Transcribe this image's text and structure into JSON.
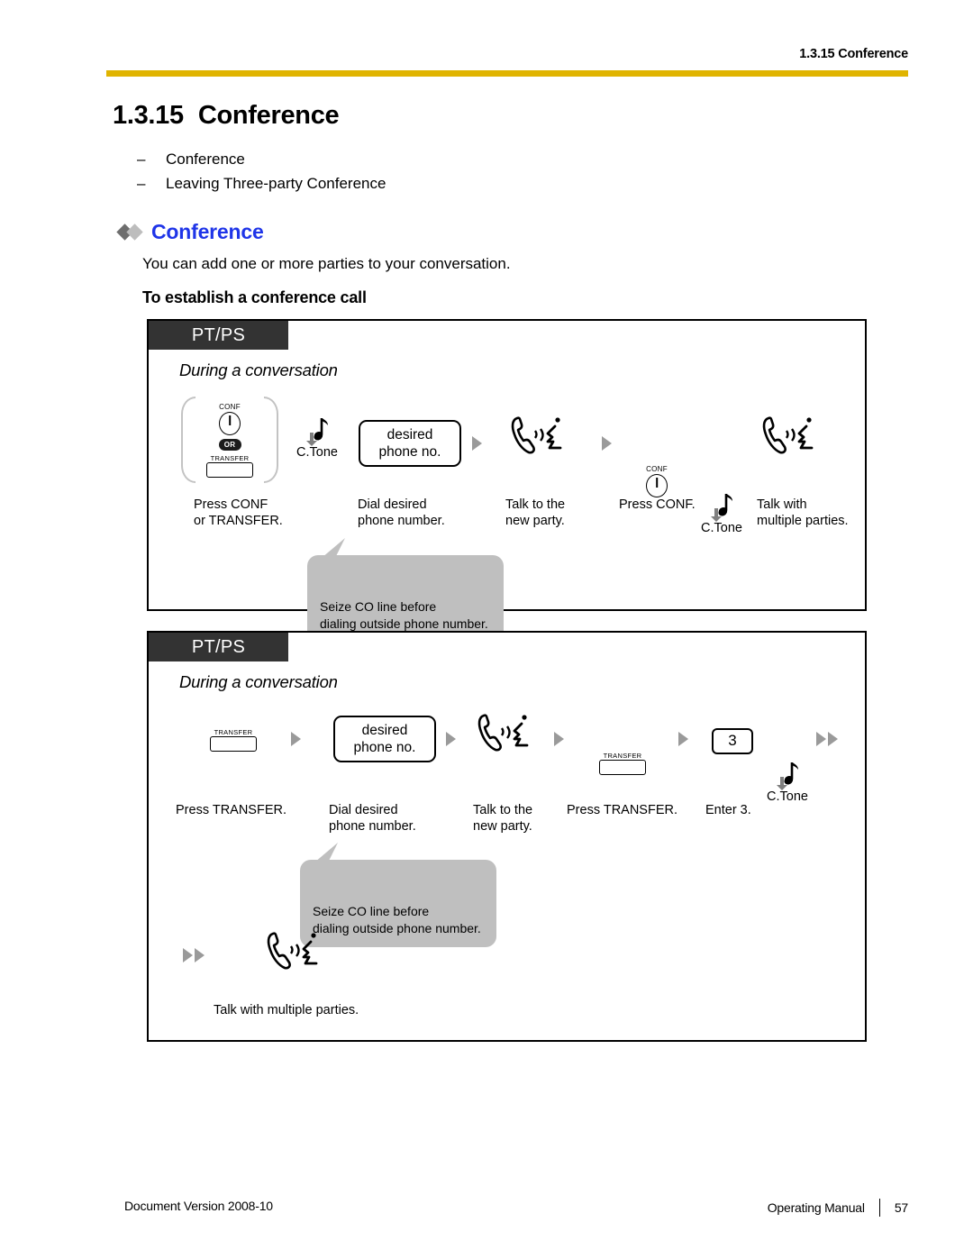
{
  "header": {
    "running_title": "1.3.15 Conference",
    "rule_color": "#e0b400"
  },
  "title": {
    "number": "1.3.15",
    "text": "Conference"
  },
  "toc_items": [
    {
      "dash": "–",
      "label": "Conference"
    },
    {
      "dash": "–",
      "label": "Leaving Three-party Conference"
    }
  ],
  "section": {
    "heading": "Conference",
    "heading_color": "#1f35e8",
    "intro": "You can add one or more parties to your conversation.",
    "subheading": "To establish a conference call"
  },
  "diagram1": {
    "badge": "PT/PS",
    "context": "During a conversation",
    "steps": {
      "conf_key_cap": "CONF",
      "or_badge": "OR",
      "transfer_key_cap": "TRANSFER",
      "ctone_label_1": "C.Tone",
      "phone_no_box": "desired\nphone no.",
      "conf_key_cap_2": "CONF",
      "ctone_label_2": "C.Tone"
    },
    "captions": [
      "Press CONF\nor TRANSFER.",
      "Dial desired\nphone number.",
      "Talk to the\nnew party.",
      "Press CONF.",
      "Talk with\nmultiple parties."
    ],
    "callout": "Seize CO line before\ndialing outside phone number."
  },
  "diagram2": {
    "badge": "PT/PS",
    "context": "During a conversation",
    "steps": {
      "transfer_key_cap_1": "TRANSFER",
      "phone_no_box": "desired\nphone no.",
      "transfer_key_cap_2": "TRANSFER",
      "digit_key": "3",
      "ctone_label": "C.Tone"
    },
    "captions": [
      "Press TRANSFER.",
      "Dial desired\nphone number.",
      "Talk to the\nnew party.",
      "Press TRANSFER.",
      "Enter 3."
    ],
    "callout": "Seize CO line before\ndialing outside phone number.",
    "final_caption": "Talk with multiple parties."
  },
  "footer": {
    "left": "Document Version  2008-10",
    "manual": "Operating Manual",
    "page": "57"
  }
}
